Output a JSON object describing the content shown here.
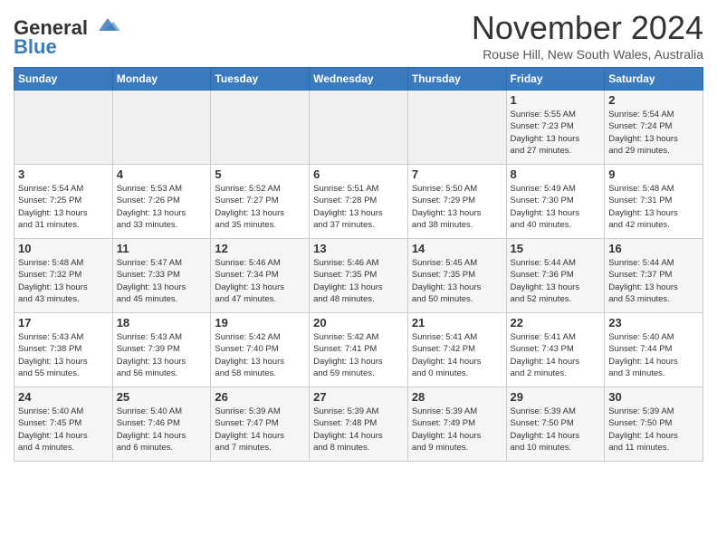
{
  "logo": {
    "line1": "General",
    "line2": "Blue"
  },
  "title": "November 2024",
  "subtitle": "Rouse Hill, New South Wales, Australia",
  "weekdays": [
    "Sunday",
    "Monday",
    "Tuesday",
    "Wednesday",
    "Thursday",
    "Friday",
    "Saturday"
  ],
  "weeks": [
    [
      {
        "day": "",
        "info": ""
      },
      {
        "day": "",
        "info": ""
      },
      {
        "day": "",
        "info": ""
      },
      {
        "day": "",
        "info": ""
      },
      {
        "day": "",
        "info": ""
      },
      {
        "day": "1",
        "info": "Sunrise: 5:55 AM\nSunset: 7:23 PM\nDaylight: 13 hours\nand 27 minutes."
      },
      {
        "day": "2",
        "info": "Sunrise: 5:54 AM\nSunset: 7:24 PM\nDaylight: 13 hours\nand 29 minutes."
      }
    ],
    [
      {
        "day": "3",
        "info": "Sunrise: 5:54 AM\nSunset: 7:25 PM\nDaylight: 13 hours\nand 31 minutes."
      },
      {
        "day": "4",
        "info": "Sunrise: 5:53 AM\nSunset: 7:26 PM\nDaylight: 13 hours\nand 33 minutes."
      },
      {
        "day": "5",
        "info": "Sunrise: 5:52 AM\nSunset: 7:27 PM\nDaylight: 13 hours\nand 35 minutes."
      },
      {
        "day": "6",
        "info": "Sunrise: 5:51 AM\nSunset: 7:28 PM\nDaylight: 13 hours\nand 37 minutes."
      },
      {
        "day": "7",
        "info": "Sunrise: 5:50 AM\nSunset: 7:29 PM\nDaylight: 13 hours\nand 38 minutes."
      },
      {
        "day": "8",
        "info": "Sunrise: 5:49 AM\nSunset: 7:30 PM\nDaylight: 13 hours\nand 40 minutes."
      },
      {
        "day": "9",
        "info": "Sunrise: 5:48 AM\nSunset: 7:31 PM\nDaylight: 13 hours\nand 42 minutes."
      }
    ],
    [
      {
        "day": "10",
        "info": "Sunrise: 5:48 AM\nSunset: 7:32 PM\nDaylight: 13 hours\nand 43 minutes."
      },
      {
        "day": "11",
        "info": "Sunrise: 5:47 AM\nSunset: 7:33 PM\nDaylight: 13 hours\nand 45 minutes."
      },
      {
        "day": "12",
        "info": "Sunrise: 5:46 AM\nSunset: 7:34 PM\nDaylight: 13 hours\nand 47 minutes."
      },
      {
        "day": "13",
        "info": "Sunrise: 5:46 AM\nSunset: 7:35 PM\nDaylight: 13 hours\nand 48 minutes."
      },
      {
        "day": "14",
        "info": "Sunrise: 5:45 AM\nSunset: 7:35 PM\nDaylight: 13 hours\nand 50 minutes."
      },
      {
        "day": "15",
        "info": "Sunrise: 5:44 AM\nSunset: 7:36 PM\nDaylight: 13 hours\nand 52 minutes."
      },
      {
        "day": "16",
        "info": "Sunrise: 5:44 AM\nSunset: 7:37 PM\nDaylight: 13 hours\nand 53 minutes."
      }
    ],
    [
      {
        "day": "17",
        "info": "Sunrise: 5:43 AM\nSunset: 7:38 PM\nDaylight: 13 hours\nand 55 minutes."
      },
      {
        "day": "18",
        "info": "Sunrise: 5:43 AM\nSunset: 7:39 PM\nDaylight: 13 hours\nand 56 minutes."
      },
      {
        "day": "19",
        "info": "Sunrise: 5:42 AM\nSunset: 7:40 PM\nDaylight: 13 hours\nand 58 minutes."
      },
      {
        "day": "20",
        "info": "Sunrise: 5:42 AM\nSunset: 7:41 PM\nDaylight: 13 hours\nand 59 minutes."
      },
      {
        "day": "21",
        "info": "Sunrise: 5:41 AM\nSunset: 7:42 PM\nDaylight: 14 hours\nand 0 minutes."
      },
      {
        "day": "22",
        "info": "Sunrise: 5:41 AM\nSunset: 7:43 PM\nDaylight: 14 hours\nand 2 minutes."
      },
      {
        "day": "23",
        "info": "Sunrise: 5:40 AM\nSunset: 7:44 PM\nDaylight: 14 hours\nand 3 minutes."
      }
    ],
    [
      {
        "day": "24",
        "info": "Sunrise: 5:40 AM\nSunset: 7:45 PM\nDaylight: 14 hours\nand 4 minutes."
      },
      {
        "day": "25",
        "info": "Sunrise: 5:40 AM\nSunset: 7:46 PM\nDaylight: 14 hours\nand 6 minutes."
      },
      {
        "day": "26",
        "info": "Sunrise: 5:39 AM\nSunset: 7:47 PM\nDaylight: 14 hours\nand 7 minutes."
      },
      {
        "day": "27",
        "info": "Sunrise: 5:39 AM\nSunset: 7:48 PM\nDaylight: 14 hours\nand 8 minutes."
      },
      {
        "day": "28",
        "info": "Sunrise: 5:39 AM\nSunset: 7:49 PM\nDaylight: 14 hours\nand 9 minutes."
      },
      {
        "day": "29",
        "info": "Sunrise: 5:39 AM\nSunset: 7:50 PM\nDaylight: 14 hours\nand 10 minutes."
      },
      {
        "day": "30",
        "info": "Sunrise: 5:39 AM\nSunset: 7:50 PM\nDaylight: 14 hours\nand 11 minutes."
      }
    ]
  ]
}
